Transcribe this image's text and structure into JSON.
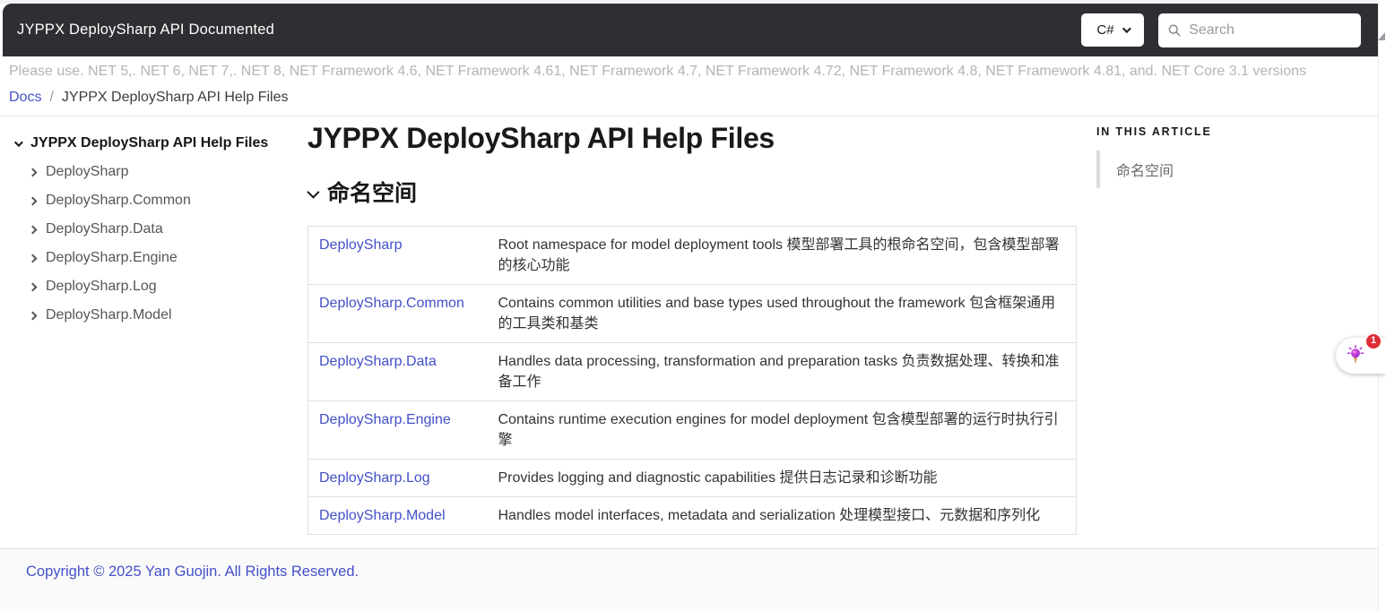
{
  "header": {
    "brand": "JYPPX DeploySharp API Documented",
    "language_selector": {
      "value": "C#"
    },
    "search": {
      "placeholder": "Search"
    }
  },
  "notice": "Please use. NET 5,. NET 6, NET 7,. NET 8, NET Framework 4.6, NET Framework 4.61, NET Framework 4.7, NET Framework 4.72, NET Framework 4.8, NET Framework 4.81, and. NET Core 3.1 versions",
  "breadcrumb": {
    "root": "Docs",
    "separator": "/",
    "current": "JYPPX DeploySharp API Help Files"
  },
  "sidebar": {
    "items": [
      {
        "label": "JYPPX DeploySharp API Help Files",
        "expanded": true,
        "active": true
      },
      {
        "label": "DeploySharp",
        "expanded": false
      },
      {
        "label": "DeploySharp.Common",
        "expanded": false
      },
      {
        "label": "DeploySharp.Data",
        "expanded": false
      },
      {
        "label": "DeploySharp.Engine",
        "expanded": false
      },
      {
        "label": "DeploySharp.Log",
        "expanded": false
      },
      {
        "label": "DeploySharp.Model",
        "expanded": false
      }
    ]
  },
  "main": {
    "title": "JYPPX DeploySharp API Help Files",
    "section_heading": "命名空间",
    "namespaces": [
      {
        "name": "DeploySharp",
        "description": "Root namespace for model deployment tools 模型部署工具的根命名空间，包含模型部署的核心功能"
      },
      {
        "name": "DeploySharp.Common",
        "description": "Contains common utilities and base types used throughout the framework 包含框架通用的工具类和基类"
      },
      {
        "name": "DeploySharp.Data",
        "description": "Handles data processing, transformation and preparation tasks 负责数据处理、转换和准备工作"
      },
      {
        "name": "DeploySharp.Engine",
        "description": "Contains runtime execution engines for model deployment 包含模型部署的运行时执行引擎"
      },
      {
        "name": "DeploySharp.Log",
        "description": "Provides logging and diagnostic capabilities 提供日志记录和诊断功能"
      },
      {
        "name": "DeploySharp.Model",
        "description": "Handles model interfaces, metadata and serialization 处理模型接口、元数据和序列化"
      }
    ]
  },
  "aside": {
    "heading": "IN THIS ARTICLE",
    "items": [
      "命名空间"
    ]
  },
  "footer": {
    "copyright": "Copyright © 2025 Yan Guojin. All Rights Reserved."
  },
  "floating_widget": {
    "badge_count": "1"
  },
  "colors": {
    "accent": "#4350C8",
    "header_bg": "#2F2F33",
    "badge_red": "#E02B35"
  }
}
